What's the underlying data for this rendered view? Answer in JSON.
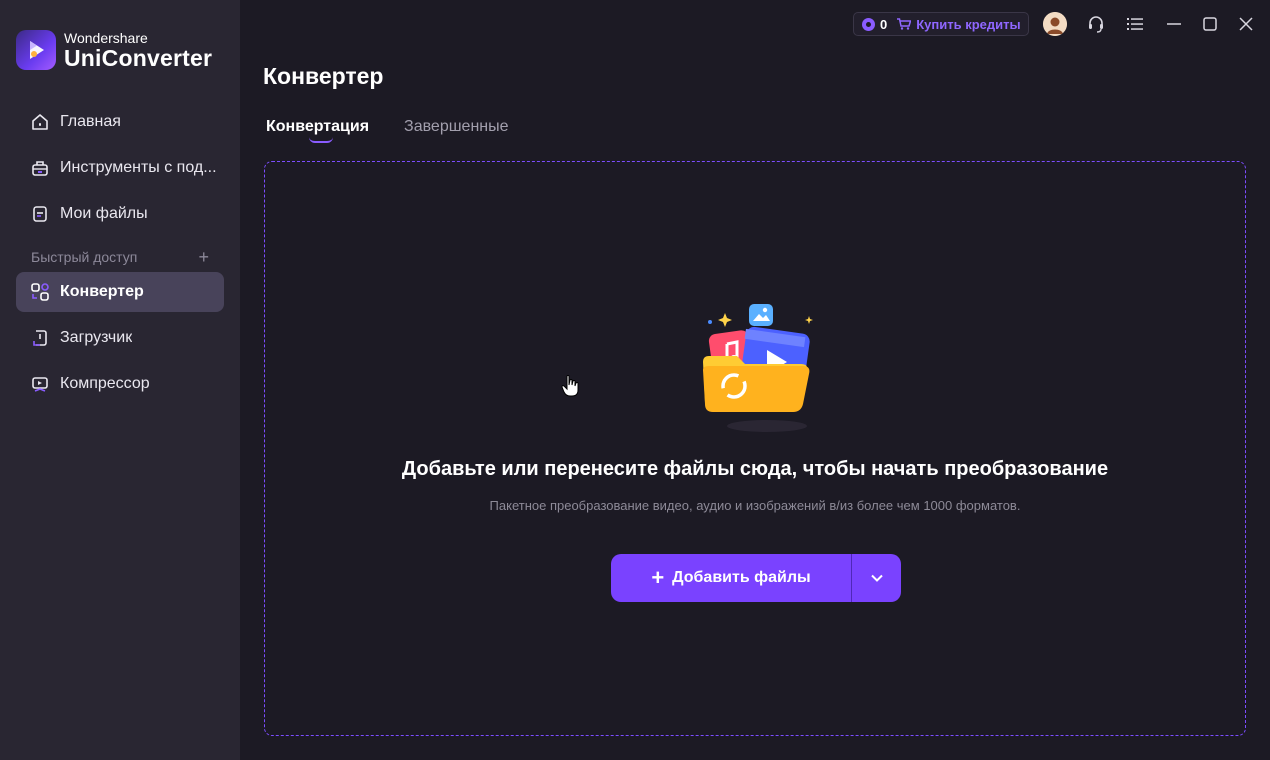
{
  "app": {
    "brand": "Wondershare",
    "product": "UniConverter"
  },
  "sidebar": {
    "items": [
      {
        "label": "Главная",
        "icon": "home-icon"
      },
      {
        "label": "Инструменты с под...",
        "icon": "toolbox-icon"
      },
      {
        "label": "Мои файлы",
        "icon": "my-files-icon"
      }
    ],
    "quick_access": {
      "label": "Быстрый доступ",
      "add_symbol": "+"
    },
    "quick_items": [
      {
        "label": "Конвертер",
        "icon": "converter-icon",
        "active": true
      },
      {
        "label": "Загрузчик",
        "icon": "downloader-icon",
        "active": false
      },
      {
        "label": "Компрессор",
        "icon": "compressor-icon",
        "active": false
      }
    ]
  },
  "topbar": {
    "credits_count": "0",
    "buy_label": "Купить кредиты",
    "icons": [
      "coin-icon",
      "cart-icon",
      "avatar",
      "support-icon",
      "menu-icon",
      "minimize-icon",
      "maximize-icon",
      "close-icon"
    ]
  },
  "main": {
    "title": "Конвертер",
    "tabs": [
      {
        "label": "Конвертация",
        "active": true
      },
      {
        "label": "Завершенные",
        "active": false
      }
    ],
    "dropzone": {
      "title": "Добавьте или перенесите файлы сюда, чтобы начать преобразование",
      "subtitle": "Пакетное преобразование видео, аудио и изображений в/из более чем 1000 форматов.",
      "add_button_symbol": "+",
      "add_button_label": "Добавить файлы"
    }
  },
  "colors": {
    "accent": "#7a42ff",
    "sidebar_bg": "#292632",
    "main_bg": "#1c1a24",
    "active_item_bg": "#48435a"
  }
}
